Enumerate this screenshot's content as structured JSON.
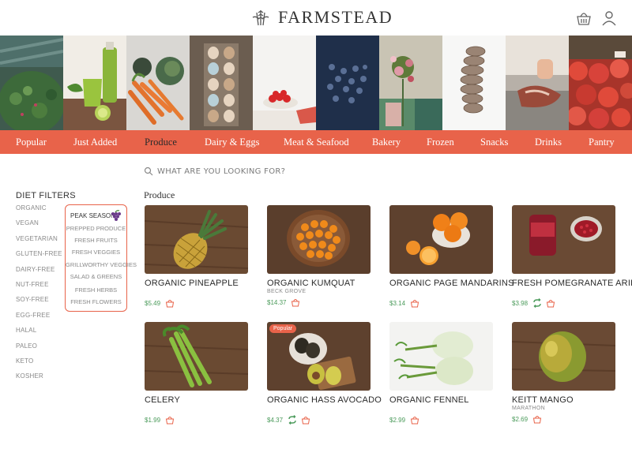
{
  "brand": {
    "name": "FARMSTEAD"
  },
  "header": {
    "icons": [
      "wheat-logo-icon",
      "basket-icon",
      "user-icon"
    ]
  },
  "photo_strip": [
    "greens",
    "green-juice",
    "carrots-and-artichokes",
    "eggs",
    "strawberries",
    "blueberries",
    "flowers",
    "bread",
    "meat",
    "pomegranates"
  ],
  "nav": {
    "items": [
      "Popular",
      "Just Added",
      "Produce",
      "Dairy & Eggs",
      "Meat & Seafood",
      "Bakery",
      "Frozen",
      "Snacks",
      "Drinks",
      "Pantry"
    ],
    "active": "Produce"
  },
  "search": {
    "placeholder": "WHAT ARE YOU LOOKING FOR?"
  },
  "diet_filters": {
    "title": "DIET FILTERS",
    "items": [
      "ORGANIC",
      "VEGAN",
      "VEGETARIAN",
      "GLUTEN-FREE",
      "DAIRY-FREE",
      "NUT-FREE",
      "SOY-FREE",
      "EGG-FREE",
      "HALAL",
      "PALEO",
      "KETO",
      "KOSHER"
    ]
  },
  "produce_menu": {
    "items": [
      "PEAK SEASON",
      "PREPPED PRODUCE",
      "FRESH FRUITS",
      "FRESH VEGGIES",
      "GRILLWORTHY VEGGIES",
      "SALAD & GREENS",
      "FRESH HERBS",
      "FRESH FLOWERS"
    ]
  },
  "section": {
    "title": "Produce"
  },
  "products": [
    {
      "name": "ORGANIC PINEAPPLE",
      "vendor": "",
      "price": "$5.49",
      "recurring": false,
      "badge": ""
    },
    {
      "name": "ORGANIC KUMQUAT",
      "vendor": "BECK GROVE",
      "price": "$14.37",
      "recurring": false,
      "badge": ""
    },
    {
      "name": "ORGANIC PAGE MANDARINS",
      "vendor": "",
      "price": "$3.14",
      "recurring": false,
      "badge": ""
    },
    {
      "name": "FRESH POMEGRANATE ARILS",
      "vendor": "",
      "price": "$3.98",
      "recurring": true,
      "badge": ""
    },
    {
      "name": "CELERY",
      "vendor": "",
      "price": "$1.99",
      "recurring": false,
      "badge": ""
    },
    {
      "name": "ORGANIC HASS AVOCADO",
      "vendor": "",
      "price": "$4.37",
      "recurring": true,
      "badge": "Popular"
    },
    {
      "name": "ORGANIC FENNEL",
      "vendor": "",
      "price": "$2.99",
      "recurring": false,
      "badge": ""
    },
    {
      "name": "KEITT MANGO",
      "vendor": "MARATHON",
      "price": "$2.69",
      "recurring": false,
      "badge": ""
    }
  ],
  "colors": {
    "accent": "#e8634a",
    "price": "#4a9a5a",
    "nav_active": "#2b2b2b"
  }
}
